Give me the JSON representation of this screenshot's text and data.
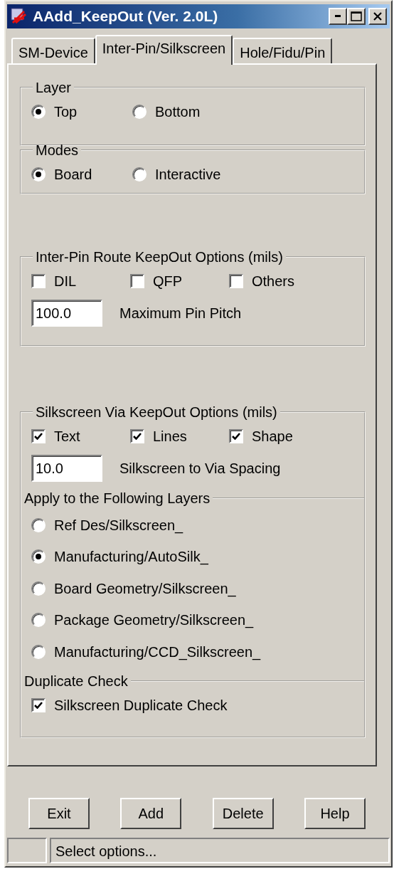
{
  "window": {
    "title": "AAdd_KeepOut (Ver. 2.0L)"
  },
  "tabs": [
    {
      "label": "SM-Device",
      "selected": false
    },
    {
      "label": "Inter-Pin/Silkscreen",
      "selected": true
    },
    {
      "label": "Hole/Fidu/Pin",
      "selected": false
    }
  ],
  "layer_group": {
    "label": "Layer",
    "options": [
      {
        "label": "Top",
        "selected": true
      },
      {
        "label": "Bottom",
        "selected": false
      }
    ]
  },
  "modes_group": {
    "label": "Modes",
    "options": [
      {
        "label": "Board",
        "selected": true
      },
      {
        "label": "Interactive",
        "selected": false
      }
    ]
  },
  "inter_pin_group": {
    "label": "Inter-Pin Route KeepOut Options (mils)",
    "checkboxes": [
      {
        "label": "DIL",
        "checked": false
      },
      {
        "label": "QFP",
        "checked": false
      },
      {
        "label": "Others",
        "checked": false
      }
    ],
    "field": {
      "value": "100.0",
      "label": "Maximum Pin Pitch"
    }
  },
  "silkscreen_group": {
    "label": "Silkscreen Via KeepOut Options (mils)",
    "checkboxes": [
      {
        "label": "Text",
        "checked": true
      },
      {
        "label": "Lines",
        "checked": true
      },
      {
        "label": "Shape",
        "checked": true
      }
    ],
    "field": {
      "value": "10.0",
      "label": "Silkscreen to Via Spacing"
    },
    "layers_section": {
      "label": "Apply to the Following Layers",
      "options": [
        {
          "label": "Ref Des/Silkscreen_",
          "selected": false
        },
        {
          "label": "Manufacturing/AutoSilk_",
          "selected": true
        },
        {
          "label": "Board Geometry/Silkscreen_",
          "selected": false
        },
        {
          "label": "Package Geometry/Silkscreen_",
          "selected": false
        },
        {
          "label": "Manufacturing/CCD_Silkscreen_",
          "selected": false
        }
      ]
    },
    "duplicate_section": {
      "label": "Duplicate Check",
      "checkboxes": [
        {
          "label": "Silkscreen Duplicate Check",
          "checked": true
        }
      ]
    }
  },
  "buttons": [
    "Exit",
    "Add",
    "Delete",
    "Help"
  ],
  "status_bar": {
    "text": "Select options..."
  }
}
